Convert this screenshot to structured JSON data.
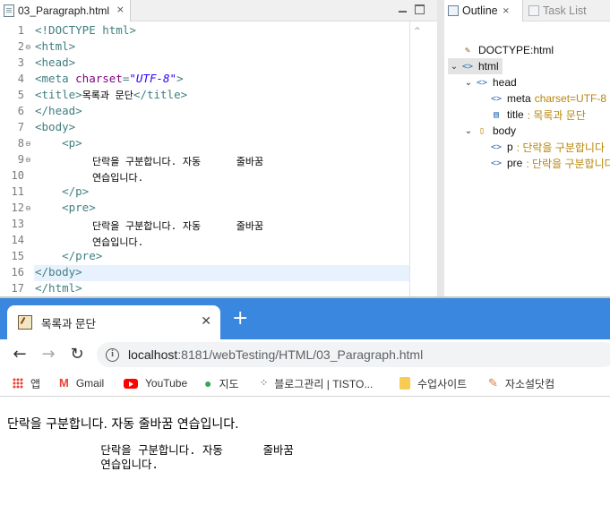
{
  "editor": {
    "tab_label": "03_Paragraph.html",
    "tab_close_glyph": "⨯",
    "overview_glyph": "^",
    "lines": [
      {
        "n": "1"
      },
      {
        "n": "2"
      },
      {
        "n": "3"
      },
      {
        "n": "4"
      },
      {
        "n": "5"
      },
      {
        "n": "6"
      },
      {
        "n": "7"
      },
      {
        "n": "8"
      },
      {
        "n": "9"
      },
      {
        "n": "10"
      },
      {
        "n": "11"
      },
      {
        "n": "12"
      },
      {
        "n": "13"
      },
      {
        "n": "14"
      },
      {
        "n": "15"
      },
      {
        "n": "16"
      },
      {
        "n": "17"
      }
    ],
    "code": {
      "l1": "<!DOCTYPE html>",
      "l2": "<html>",
      "l3": "<head>",
      "l4_tag": "<meta ",
      "l4_attr": "charset",
      "l4_eq": "=",
      "l4_val": "\"UTF-8\"",
      "l4_close": ">",
      "l5_open": "<title>",
      "l5_text": "목록과 문단",
      "l5_close": "</title>",
      "l6": "</head>",
      "l7": "<body>",
      "l8": "    <p>",
      "l9": "단락을 구분합니다. 자동      줄바꿈",
      "l10": "연습입니다.",
      "l11": "    </p>",
      "l12": "    <pre>",
      "l13": "단락을 구분합니다. 자동      줄바꿈",
      "l14": "연습입니다.",
      "l15": "    </pre>",
      "l16": "</body>",
      "l17": "</html>"
    }
  },
  "outline": {
    "tab_outline": "Outline",
    "tab_close_glyph": "⨯",
    "tab_tasks": "Task List",
    "nodes": {
      "doctype": "DOCTYPE:html",
      "html": "html",
      "head": "head",
      "meta": "meta",
      "meta_extra": "charset=UTF-8",
      "title": "title",
      "title_extra": ": 목록과 문단",
      "body": "body",
      "p": "p",
      "p_extra": ": 단락을 구분합니다",
      "pre": "pre",
      "pre_extra": ": 단락을 구분합니다"
    }
  },
  "browser": {
    "tab_title": "목록과 문단",
    "tab_close_glyph": "✕",
    "new_tab_glyph": "+",
    "url_host": "localhost",
    "url_path": ":8181/webTesting/HTML/03_Paragraph.html",
    "bookmarks": {
      "apps": "앱",
      "gmail": "Gmail",
      "youtube": "YouTube",
      "maps": "지도",
      "tistory": "블로그관리 | TISTO...",
      "folder": "수업사이트",
      "pencil": "자소설닷컴"
    },
    "page": {
      "paragraph": "단락을 구분합니다. 자동 줄바꿈 연습입니다.",
      "pre_line1": "              단락을 구분합니다. 자동      줄바꿈",
      "pre_line2": "              연습입니다."
    }
  },
  "icons": {
    "editor_file": "html-file-icon",
    "outline": "outline-icon",
    "tasks": "task-list-icon",
    "back": "back-arrow-icon",
    "forward": "forward-arrow-icon",
    "reload": "reload-icon",
    "info": "info-icon"
  }
}
